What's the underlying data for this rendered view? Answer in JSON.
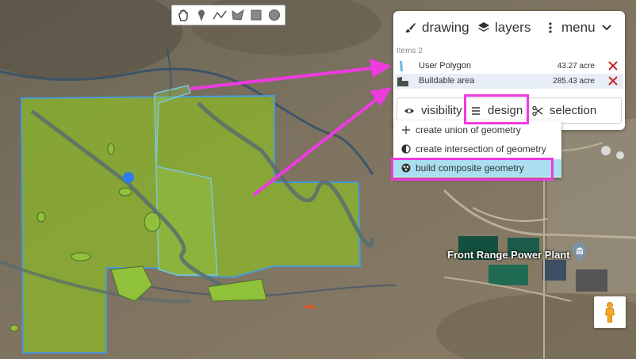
{
  "colors": {
    "accent": "#ef3ae0",
    "polygon_fill": "#8ab52c",
    "polygon_stroke": "#4a9ad4",
    "remove": "#c62828",
    "selected_row": "#e8eef8",
    "dropdown_hover": "#a9dff0"
  },
  "toolbar": {
    "tools": [
      {
        "icon": "hand-pan-icon"
      },
      {
        "icon": "marker-icon"
      },
      {
        "icon": "polyline-icon"
      },
      {
        "icon": "polygon-icon"
      },
      {
        "icon": "rectangle-icon"
      },
      {
        "icon": "circle-icon"
      }
    ]
  },
  "panel": {
    "header": {
      "drawing": "drawing",
      "layers": "layers",
      "menu": "menu"
    },
    "items_count": "Items 2",
    "layers": [
      {
        "name": "User Polygon",
        "area": "43.27 acre",
        "icon": "polygon-layer-icon"
      },
      {
        "name": "Buildable area",
        "area": "285.43 acre",
        "icon": "area-layer-icon"
      }
    ],
    "tabs": {
      "visibility": "visibility",
      "design": "design",
      "selection": "selection"
    }
  },
  "dropdown": {
    "items": [
      {
        "label": "create union of geometry",
        "icon": "plus-icon"
      },
      {
        "label": "create intersection of geometry",
        "icon": "intersection-icon"
      },
      {
        "label": "build composite geometry",
        "icon": "composite-icon"
      }
    ]
  },
  "map": {
    "place_label": "Front Range Power Plant"
  }
}
